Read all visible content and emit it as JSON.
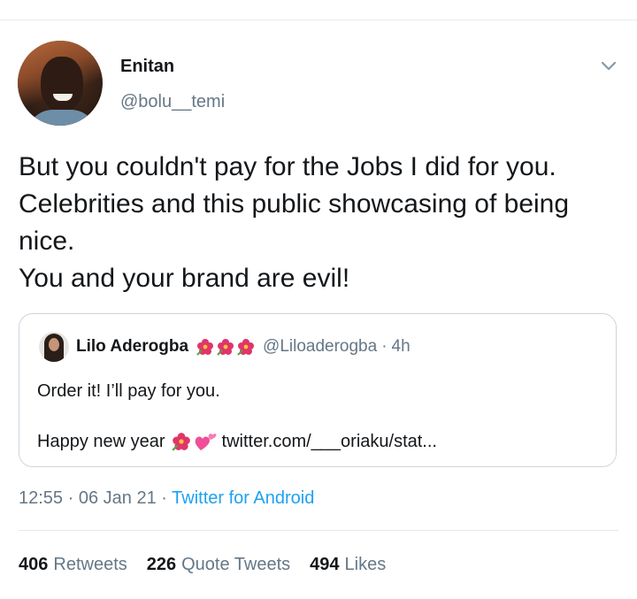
{
  "tweet": {
    "display_name": "Enitan",
    "handle": "@bolu__temi",
    "text_lines": [
      "But you couldn't pay for the Jobs I did for you.",
      "Celebrities and this public showcasing of being",
      "nice.",
      "You and your brand are evil!"
    ],
    "timestamp_time": "12:55",
    "timestamp_date": "06 Jan 21",
    "separator": "·",
    "source": "Twitter for Android"
  },
  "quoted_tweet": {
    "display_name": "Lilo Aderogba",
    "name_emojis": [
      "flower-icon",
      "flower-icon",
      "flower-icon"
    ],
    "handle": "@Liloaderogba",
    "separator": "·",
    "time_ago": "4h",
    "line1": "Order it! I’ll pay for you.",
    "line2_text": "Happy new year",
    "line2_emojis": [
      "flower-icon",
      "two-hearts-icon"
    ],
    "link": "twitter.com/___oriaku/stat..."
  },
  "stats": {
    "retweets_count": "406",
    "retweets_label": "Retweets",
    "quote_count": "226",
    "quote_label": "Quote Tweets",
    "likes_count": "494",
    "likes_label": "Likes"
  },
  "colors": {
    "text_primary": "#14171a",
    "text_secondary": "#657786",
    "link_blue": "#1da1f2",
    "border": "#ccd6dd",
    "flower_pink": "#e0356a",
    "heart_pink": "#f04e98"
  }
}
